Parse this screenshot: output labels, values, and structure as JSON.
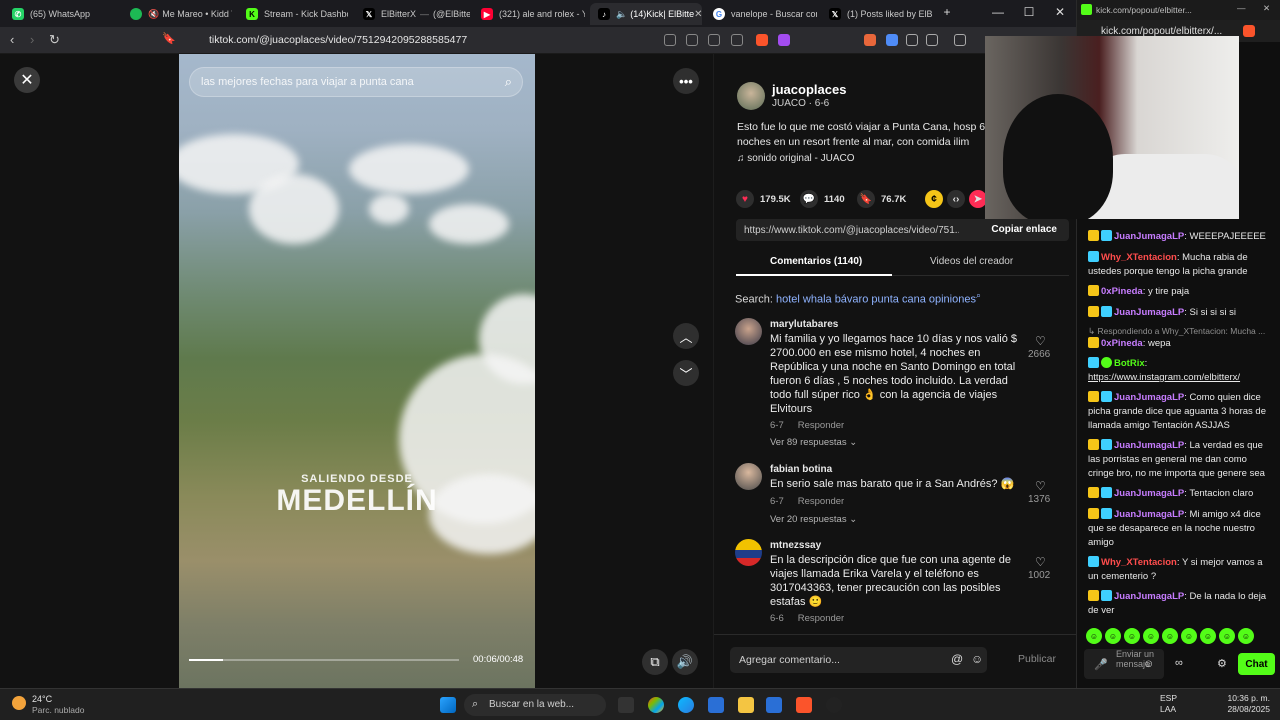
{
  "browser": {
    "tabs": [
      {
        "label": "(65) WhatsApp",
        "icon": "whatsapp-icon",
        "color": "#25d366"
      },
      {
        "label": "Me Mareo • Kidd V",
        "icon": "spotify-icon",
        "color": "#1db954"
      },
      {
        "label": "Stream - Kick Dashboa",
        "icon": "kick-icon",
        "color": "#53fc18"
      },
      {
        "label": "ElBitterX",
        "icon": "x-icon",
        "color": "#000000"
      },
      {
        "label": "(@ElBitter",
        "icon": "x-icon",
        "color": "#000000"
      },
      {
        "label": "(321) ale and rolex - Yo",
        "icon": "youtube-icon",
        "color": "#ff0033"
      },
      {
        "label": "(14)Kick| ElBitte",
        "icon": "tiktok-icon",
        "color": "#000000"
      },
      {
        "label": "vanelope - Buscar con",
        "icon": "google-icon",
        "color": "#4285f4"
      },
      {
        "label": "(1) Posts liked by ElBitte",
        "icon": "x-icon",
        "color": "#000000"
      }
    ],
    "url": "tiktok.com/@juacoplaces/video/7512942095288585477"
  },
  "video": {
    "search_placeholder": "las mejores fechas para viajar a punta cana",
    "overlay_small": "SALIENDO DESDE",
    "overlay_big": "MEDELLÍN",
    "time": "00:06/00:48",
    "progress": 0.125
  },
  "post": {
    "author": "juacoplaces",
    "author_sub": "JUACO · 6-6",
    "description": "Esto fue lo que me costó viajar a Punta Cana, hosp 6 noches en un resort frente al mar, con comida ilim",
    "sound": "sonido original - JUACO",
    "likes": "179.5K",
    "comments": "1140",
    "saves": "76.7K",
    "link": "https://www.tiktok.com/@juacoplaces/video/751...",
    "copy_link": "Copiar enlace",
    "tab_comments": "Comentarios (1140)",
    "tab_videos": "Videos del creador",
    "search_label": "Search:",
    "search_query": "hotel whala bávaro punta cana opiniones",
    "comment_placeholder": "Agregar comentario...",
    "publish": "Publicar"
  },
  "comments": [
    {
      "name": "marylutabares",
      "text": "Mi familia y yo llegamos hace 10 días y nos valió $ 2700.000 en ese mismo hotel, 4 noches en República y una noche en Santo Domingo en total fueron 6 días , 5 noches todo incluido. La verdad todo full súper rico 👌 con la agencia de viajes Elvitours",
      "date": "6-7",
      "reply": "Responder",
      "likes": "2666",
      "more": "Ver 89 respuestas ⌄"
    },
    {
      "name": "fabian botina",
      "text": "En serio sale mas barato que ir a San Andrés? 😱",
      "date": "6-7",
      "reply": "Responder",
      "likes": "1376",
      "more": "Ver 20 respuestas ⌄"
    },
    {
      "name": "mtnezssay",
      "text": "En la descripción dice que fue con una agente de viajes llamada Erika Varela y el teléfono es 3017043363, tener precaución con las posibles estafas 🙂",
      "date": "6-6",
      "reply": "Responder",
      "likes": "1002",
      "more": ""
    }
  ],
  "chat": {
    "title": "kick.com/popout/elbitter...",
    "url": "kick.com/popout/elbitterx/...",
    "messages": [
      {
        "user": "JuanJumagaLP",
        "color": "#c77dff",
        "text": "WEEEPAJEEEEE"
      },
      {
        "user": "Why_XTentacion",
        "color": "#ff4d4d",
        "text": "Mucha rabia de ustedes porque tengo la picha grande"
      },
      {
        "user": "0xPineda",
        "color": "#c77dff",
        "text": "y tire paja"
      },
      {
        "user": "JuanJumagaLP",
        "color": "#c77dff",
        "text": "Si si si si si"
      },
      {
        "reply_to": "Respondiendo a Why_XTentacion: Mucha ..."
      },
      {
        "user": "0xPineda",
        "color": "#c77dff",
        "text": "wepa"
      },
      {
        "user": "BotRix",
        "color": "#53fc18",
        "text": ""
      },
      {
        "link": "https://www.instagram.com/elbitterx/"
      },
      {
        "user": "JuanJumagaLP",
        "color": "#c77dff",
        "text": "Como quien dice picha grande dice que aguanta 3 horas de llamada amigo Tentación ASJJAS"
      },
      {
        "user": "JuanJumagaLP",
        "color": "#c77dff",
        "text": "La verdad es que las porristas en general me dan como cringe bro, no me importa que genere sea"
      },
      {
        "user": "JuanJumagaLP",
        "color": "#c77dff",
        "text": "Tentacion claro"
      },
      {
        "user": "JuanJumagaLP",
        "color": "#c77dff",
        "text": "Mi amigo x4 dice que se desaparece en la noche nuestro amigo"
      },
      {
        "user": "Why_XTentacion",
        "color": "#ff4d4d",
        "text": "Y si mejor vamos a un cementerio ?"
      },
      {
        "user": "JuanJumagaLP",
        "color": "#c77dff",
        "text": "De la nada lo deja de ver"
      }
    ],
    "input_placeholder": "Enviar un mensaje",
    "send_label": "Chat",
    "accent": "#53fc18"
  },
  "taskbar": {
    "weather_temp": "24°C",
    "weather_desc": "Parc. nublado",
    "search_placeholder": "Buscar en la web...",
    "lang": "ESP",
    "lang_sub": "LAA",
    "time": "10:36 p. m.",
    "date": "28/08/2025"
  }
}
